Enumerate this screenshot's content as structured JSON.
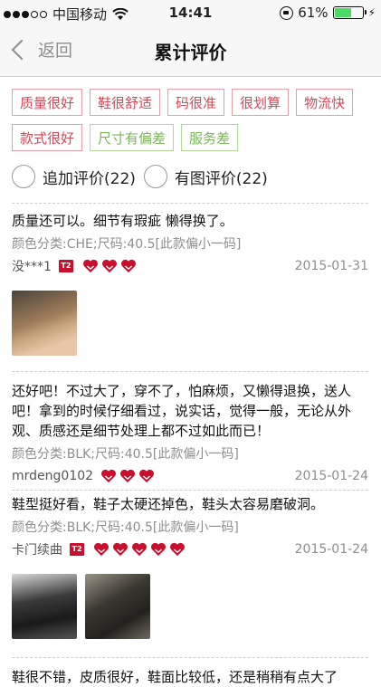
{
  "status_bar": {
    "carrier": "中国移动",
    "time": "14:41",
    "battery": "61%",
    "battery_level": 0.61
  },
  "nav": {
    "back_label": "返回",
    "title": "累计评价"
  },
  "tags": [
    {
      "label": "质量很好",
      "tone": "red"
    },
    {
      "label": "鞋很舒适",
      "tone": "red"
    },
    {
      "label": "码很准",
      "tone": "red"
    },
    {
      "label": "很划算",
      "tone": "red"
    },
    {
      "label": "物流快",
      "tone": "red"
    },
    {
      "label": "款式很好",
      "tone": "red"
    },
    {
      "label": "尺寸有偏差",
      "tone": "green"
    },
    {
      "label": "服务差",
      "tone": "green"
    }
  ],
  "filters": {
    "followup_label": "追加评价(22)",
    "photo_label": "有图评价(22)"
  },
  "reviews": [
    {
      "text": "质量还可以。细节有瑕疵 懒得换了。",
      "meta": "颜色分类:CHE;尺码:40.5[此款偏小一码]",
      "user": "没***1",
      "badge": "T2",
      "hearts": 3,
      "date": "2015-01-31",
      "photos": 1
    },
    {
      "text": "还好吧！不过大了，穿不了，怕麻烦，又懒得退换，送人吧！拿到的时候仔细看过，说实话，觉得一般，无论从外观、质感还是细节处理上都不过如此而已！",
      "meta": "颜色分类:BLK;尺码:40.5[此款偏小一码]",
      "user": "mrdeng0102",
      "hearts": 3,
      "date": "2015-01-24"
    },
    {
      "text": "鞋型挺好看，鞋子太硬还掉色，鞋头太容易磨破洞。",
      "meta": "颜色分类:BLK;尺码:40.5[此款偏小一码]",
      "user": "卡门续曲",
      "badge": "T2",
      "hearts": 5,
      "date": "2015-01-24",
      "photos": 2
    },
    {
      "text": "鞋很不错，皮质很好，鞋面比较低，还是稍稍有点大了"
    }
  ],
  "colors": {
    "tag_red": "#d04a58",
    "tag_green": "#7db55a",
    "heart": "#c8102e",
    "battery": "#4cd964"
  }
}
